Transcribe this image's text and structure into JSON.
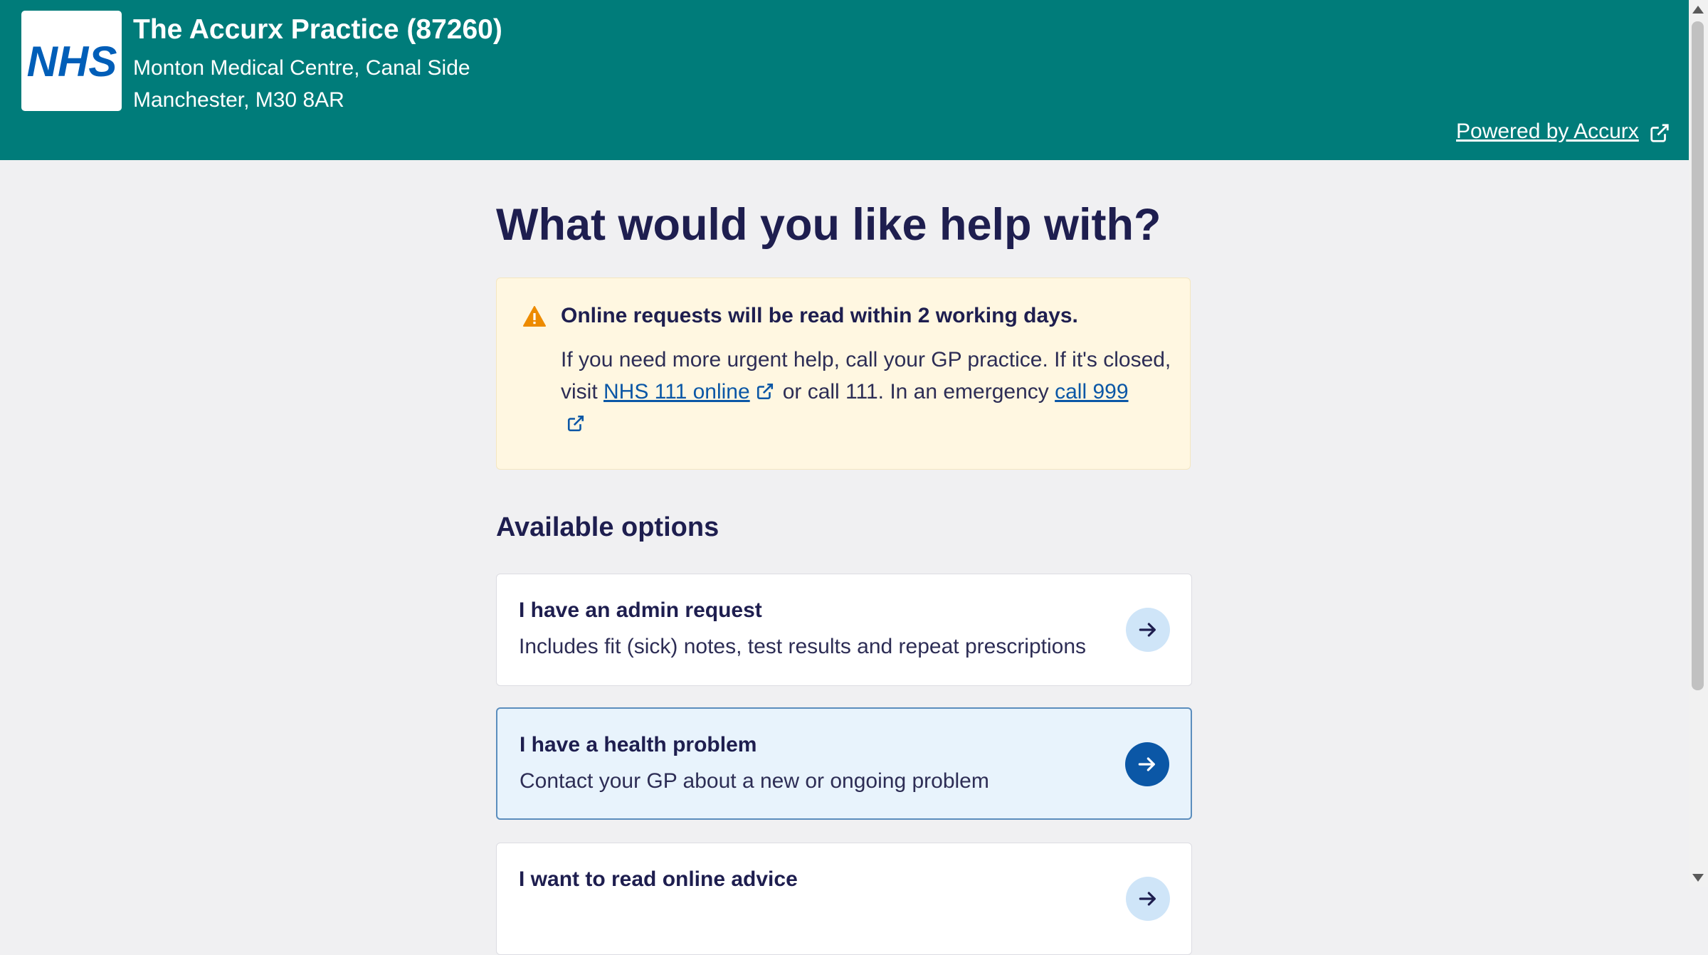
{
  "header": {
    "logo_text": "NHS",
    "practice_name": "The Accurx Practice (87260)",
    "address_line1": "Monton Medical Centre, Canal Side",
    "address_line2": "Manchester, M30 8AR",
    "powered_by": "Powered by Accurx"
  },
  "main": {
    "title": "What would you like help with?",
    "warning": {
      "title": "Online requests will be read within 2 working days.",
      "body_part1": "If you need more urgent help, call your GP practice. If it's closed, visit ",
      "link_nhs111": "NHS 111 online",
      "body_part2": "or call 111. In an emergency ",
      "link_999": "call 999"
    },
    "options_heading": "Available options",
    "options": [
      {
        "title": "I have an admin request",
        "description": "Includes fit (sick) notes, test results and repeat prescriptions"
      },
      {
        "title": "I have a health problem",
        "description": "Contact your GP about a new or ongoing problem"
      },
      {
        "title": "I want to read online advice",
        "description": ""
      }
    ]
  },
  "colors": {
    "header_bg": "#007c7a",
    "nhs_blue": "#005eb8",
    "title_text": "#1e1e4f",
    "warning_bg": "#fff7e1",
    "warning_icon": "#ed8b00",
    "link": "#0b57a6",
    "selected_option_bg": "#e8f3fc"
  },
  "icons": {
    "warning": "warning-triangle-icon",
    "external": "external-link-icon",
    "arrow": "arrow-right-icon"
  }
}
